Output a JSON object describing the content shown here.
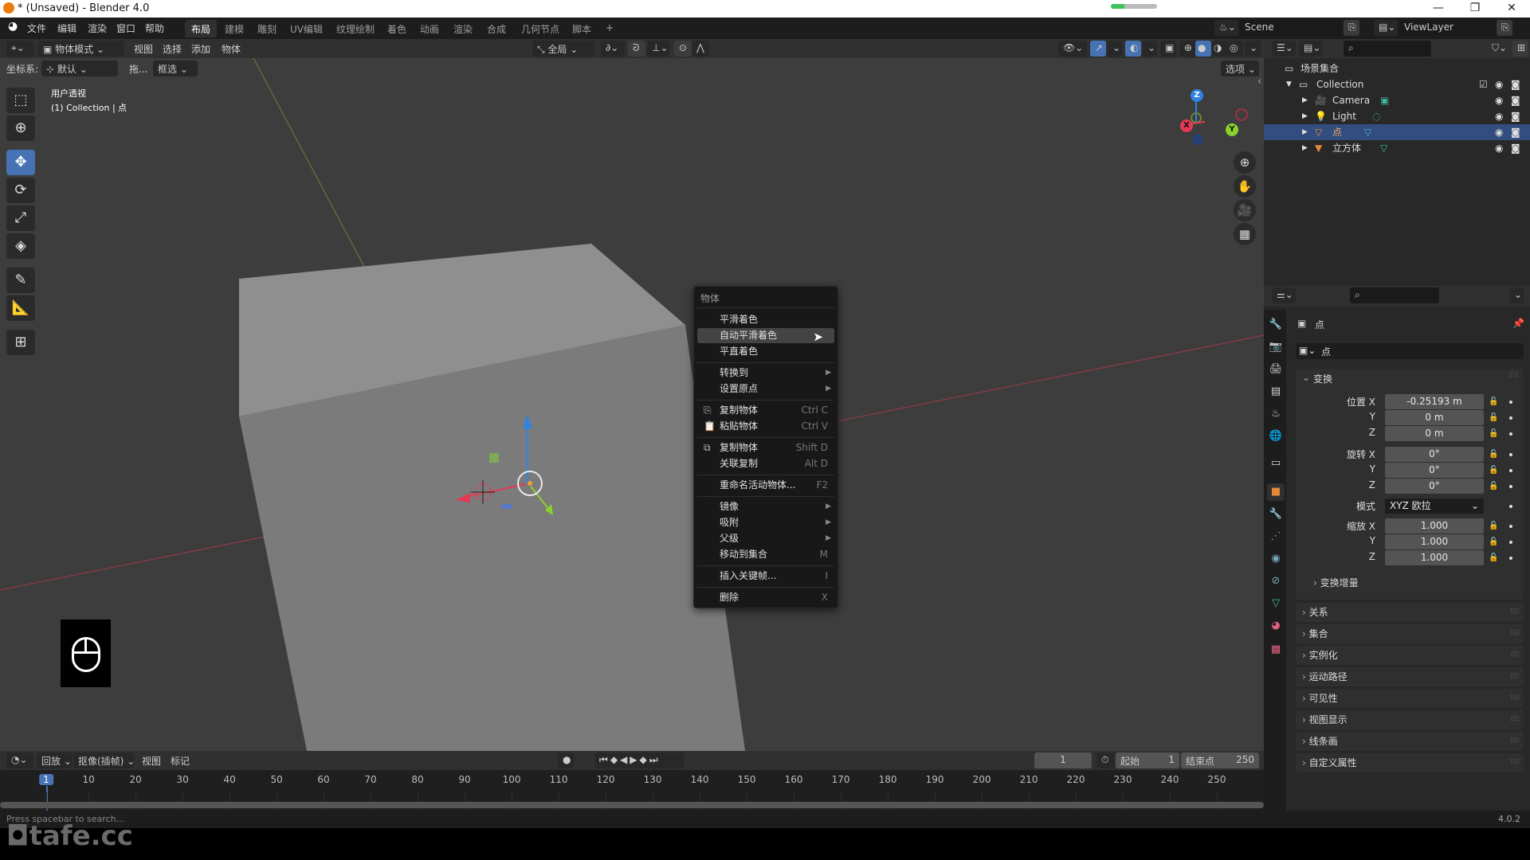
{
  "window": {
    "title": "* (Unsaved) - Blender 4.0",
    "download_progress": 0.3,
    "minimize_icon": "—",
    "restore_icon": "❐",
    "close_icon": "✕"
  },
  "menubar": {
    "items": [
      "文件",
      "编辑",
      "渲染",
      "窗口",
      "帮助"
    ],
    "workspaces": [
      "布局",
      "建模",
      "雕刻",
      "UV编辑",
      "纹理绘制",
      "着色",
      "动画",
      "渲染",
      "合成",
      "几何节点",
      "脚本"
    ],
    "active_workspace": "布局",
    "add_workspace": "+",
    "scene": "Scene",
    "view_layer": "ViewLayer"
  },
  "viewport_header": {
    "mode": "物体模式",
    "menus": [
      "视图",
      "选择",
      "添加",
      "物体"
    ],
    "transform_orientation": "全局",
    "options": "选项"
  },
  "tool_options": {
    "coord_label": "坐标系:",
    "coord_value": "默认",
    "drag_label": "拖...",
    "drag_value": "框选"
  },
  "viewport": {
    "view_name": "用户透视",
    "collection_info": "(1) Collection | 点",
    "gizmo": {
      "x": "X",
      "y": "Y",
      "z": "Z"
    },
    "colors": {
      "x_axis": "#e33b56",
      "y_axis": "#8bd12a",
      "z_axis": "#2f83e3",
      "cube": "#7b7b7b"
    }
  },
  "tools": [
    "select-box",
    "cursor",
    "move",
    "rotate",
    "scale",
    "transform",
    "annotate",
    "measure",
    "add-cube"
  ],
  "active_tool": "move",
  "context_menu": {
    "title": "物体",
    "items": [
      {
        "label": "平滑着色",
        "shortcut": "",
        "submenu": false
      },
      {
        "label": "自动平滑着色",
        "shortcut": "",
        "submenu": false,
        "highlighted": true
      },
      {
        "label": "平直着色",
        "shortcut": "",
        "submenu": false
      },
      {
        "label": "转换到",
        "shortcut": "",
        "submenu": true
      },
      {
        "label": "设置原点",
        "shortcut": "",
        "submenu": true
      },
      {
        "label": "复制物体",
        "shortcut": "Ctrl C",
        "submenu": false,
        "icon": "copy-icon"
      },
      {
        "label": "粘贴物体",
        "shortcut": "Ctrl V",
        "submenu": false,
        "icon": "paste-icon"
      },
      {
        "label": "复制物体",
        "shortcut": "Shift D",
        "submenu": false,
        "icon": "duplicate-icon"
      },
      {
        "label": "关联复制",
        "shortcut": "Alt D",
        "submenu": false
      },
      {
        "label": "重命名活动物体...",
        "shortcut": "F2",
        "submenu": false
      },
      {
        "label": "镜像",
        "shortcut": "",
        "submenu": true
      },
      {
        "label": "吸附",
        "shortcut": "",
        "submenu": true
      },
      {
        "label": "父级",
        "shortcut": "",
        "submenu": true
      },
      {
        "label": "移动到集合",
        "shortcut": "M",
        "submenu": false
      },
      {
        "label": "插入关键帧...",
        "shortcut": "I",
        "submenu": false
      },
      {
        "label": "删除",
        "shortcut": "X",
        "submenu": false
      }
    ]
  },
  "outliner": {
    "root": "场景集合",
    "collection": "Collection",
    "objects": [
      {
        "name": "Camera",
        "selected": false
      },
      {
        "name": "Light",
        "selected": false
      },
      {
        "name": "点",
        "selected": true
      },
      {
        "name": "立方体",
        "selected": false
      }
    ]
  },
  "properties": {
    "object_name": "点",
    "name_field": "点",
    "transform_title": "变换",
    "location_label": "位置 X",
    "location": [
      "-0.25193 m",
      "0 m",
      "0 m"
    ],
    "rotation_label": "旋转 X",
    "rotation": [
      "0°",
      "0°",
      "0°"
    ],
    "mode_label": "模式",
    "rotation_mode": "XYZ 欧拉",
    "scale_label": "缩放 X",
    "scale": [
      "1.000",
      "1.000",
      "1.000"
    ],
    "axis_y": "Y",
    "axis_z": "Z",
    "delta_transform": "变换增量",
    "panels": [
      "关系",
      "集合",
      "实例化",
      "运动路径",
      "可见性",
      "视图显示",
      "线条画",
      "自定义属性"
    ]
  },
  "timeline": {
    "menus": [
      "回放",
      "抠像(插帧)",
      "视图",
      "标记"
    ],
    "current_frame": "1",
    "start_label": "起始",
    "start": "1",
    "end_label": "结束点",
    "end": "250",
    "ticks": [
      "1",
      "10",
      "20",
      "30",
      "40",
      "50",
      "60",
      "70",
      "80",
      "90",
      "100",
      "110",
      "120",
      "130",
      "140",
      "150",
      "160",
      "170",
      "180",
      "190",
      "200",
      "210",
      "220",
      "230",
      "240",
      "250"
    ]
  },
  "statusbar": {
    "hint": "Press spacebar to search...",
    "version": "4.0.2",
    "watermark": "tafe.cc"
  }
}
